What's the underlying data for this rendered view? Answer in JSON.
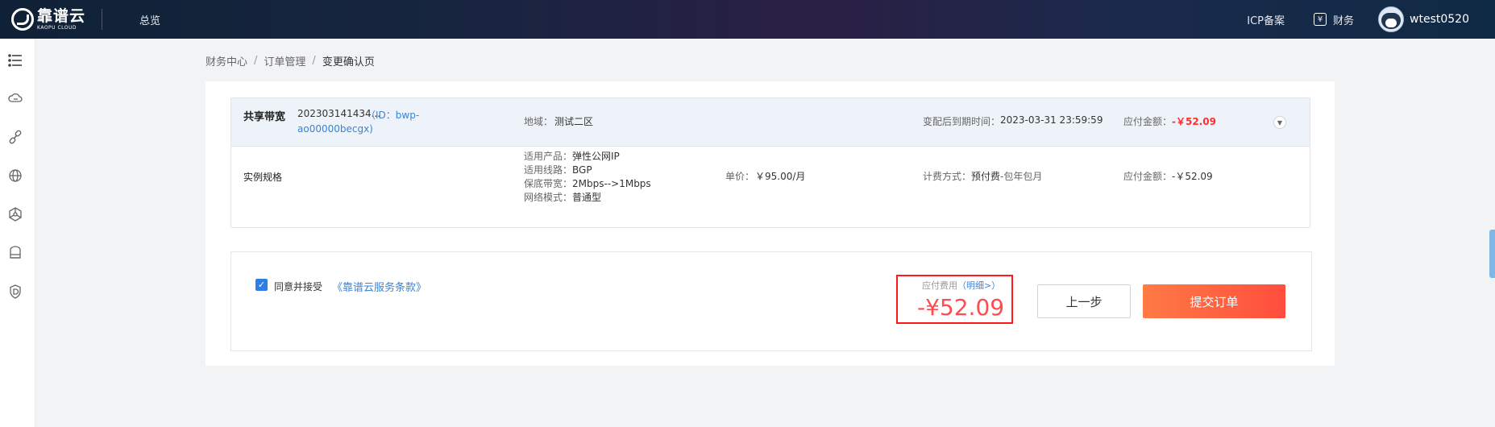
{
  "header": {
    "logo_cn": "靠谱云",
    "logo_en": "KAOPU CLOUD",
    "nav_overview": "总览",
    "icp": "ICP备案",
    "finance_icon_glyph": "¥",
    "finance": "财务",
    "username": "wtest0520"
  },
  "sidebar": {
    "icons": [
      "menu-icon",
      "cloud-icon",
      "link-icon",
      "globe-icon",
      "network-icon",
      "storage-icon",
      "shield-icon"
    ]
  },
  "breadcrumb": {
    "items": [
      "财务中心",
      "订单管理",
      "变更确认页"
    ],
    "separator": "/"
  },
  "order": {
    "product_name": "共享带宽",
    "order_number": "202303141434...",
    "id_line1": "（ID：bwp-",
    "id_line2": "ao00000becgx)",
    "region_label": "地域：",
    "region_value": "测试二区",
    "expire_label": "变配后到期时间：",
    "expire_value": "2023-03-31 23:59:59",
    "amount_label": "应付金额：",
    "amount_value": "-￥52.09",
    "spec": {
      "title": "实例规格",
      "lines": [
        {
          "label": "适用产品：",
          "value": "弹性公网IP"
        },
        {
          "label": "适用线路：",
          "value": "BGP"
        },
        {
          "label": "保底带宽：",
          "value": "2Mbps-->1Mbps"
        },
        {
          "label": "网络模式：",
          "value": "普通型"
        }
      ],
      "unit_price_label": "单价：",
      "unit_price_value": "￥95.00/月",
      "billing_label": "计费方式：",
      "billing_value": "预付费",
      "billing_suffix": "-包年包月",
      "amount_label": "应付金额：",
      "amount_value": "-￥52.09"
    }
  },
  "submit": {
    "checkbox_checked": true,
    "check_glyph": "✓",
    "agree_text": "同意并接受",
    "terms_link": "《靠谱云服务条款》",
    "fee_label": "应付费用",
    "fee_detail": "（明细>）",
    "fee_amount": "-¥52.09",
    "prev_button": "上一步",
    "submit_button": "提交订单"
  },
  "colors": {
    "accent_blue": "#3b82d6",
    "price_red": "#ff4d4f",
    "submit_gradient_start": "#ff7a45",
    "submit_gradient_end": "#ff4d3d",
    "highlight_border": "#ff1a1a"
  }
}
